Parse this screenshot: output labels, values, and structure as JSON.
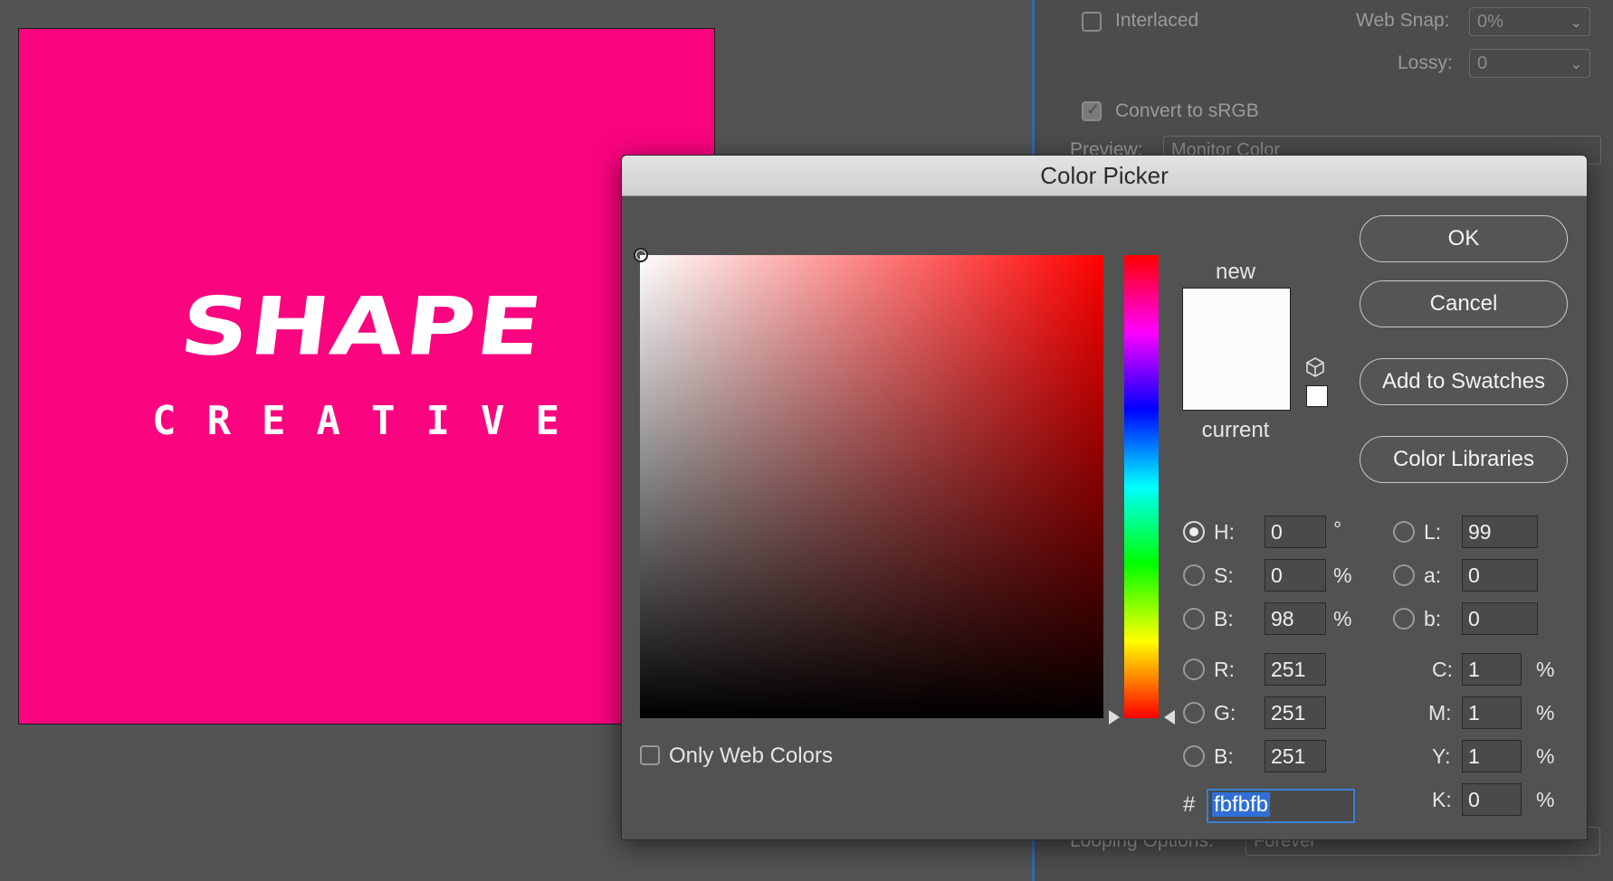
{
  "background_panel": {
    "interlaced_label": "Interlaced",
    "web_snap_label": "Web Snap:",
    "web_snap_value": "0%",
    "lossy_label": "Lossy:",
    "lossy_value": "0",
    "convert_srgb_label": "Convert to sRGB",
    "preview_label": "Preview:",
    "preview_value": "Monitor Color",
    "looping_label": "Looping Options:",
    "looping_value": "Forever"
  },
  "artwork": {
    "logo_main": "SHAPE",
    "logo_sub": "CREATIVE",
    "background_color": "#fa047f"
  },
  "dialog": {
    "title": "Color Picker",
    "new_label": "new",
    "current_label": "current",
    "new_color": "#fbfbfb",
    "current_color": "#fbfbfb",
    "buttons": {
      "ok": "OK",
      "cancel": "Cancel",
      "add_to_swatches": "Add to Swatches",
      "color_libraries": "Color Libraries"
    },
    "only_web_colors_label": "Only Web Colors",
    "hsb": {
      "h_label": "H:",
      "h_value": "0",
      "h_unit": "°",
      "s_label": "S:",
      "s_value": "0",
      "s_unit": "%",
      "b_label": "B:",
      "b_value": "98",
      "b_unit": "%"
    },
    "rgb": {
      "r_label": "R:",
      "r_value": "251",
      "g_label": "G:",
      "g_value": "251",
      "b_label": "B:",
      "b_value": "251"
    },
    "lab": {
      "l_label": "L:",
      "l_value": "99",
      "a_label": "a:",
      "a_value": "0",
      "b_label": "b:",
      "b_value": "0"
    },
    "cmyk": {
      "c_label": "C:",
      "c_value": "1",
      "m_label": "M:",
      "m_value": "1",
      "y_label": "Y:",
      "y_value": "1",
      "k_label": "K:",
      "k_value": "0",
      "unit": "%"
    },
    "hex_hash": "#",
    "hex_value": "fbfbfb"
  }
}
